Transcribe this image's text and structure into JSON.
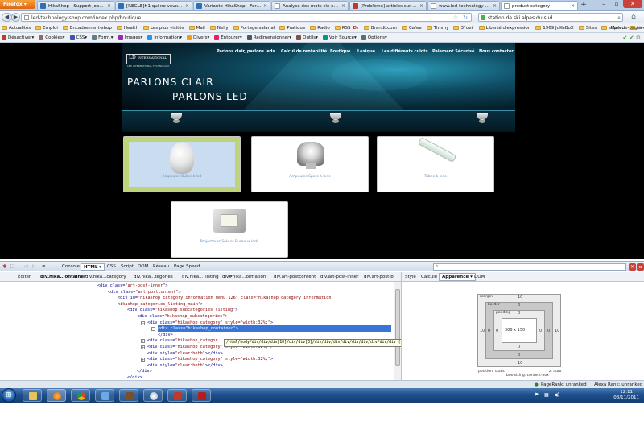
{
  "browser": {
    "app_button": "Firefox",
    "tabs": [
      {
        "label": "HikaShop - Support Joomla ..."
      },
      {
        "label": "[RÉGLÉ]H1 qui ne veux pas ..."
      },
      {
        "label": "Variante HikaShop - Formati..."
      },
      {
        "label": "Analyse des mots clé et mét..."
      },
      {
        "label": "[Problème] articles sur hikas..."
      },
      {
        "label": "www.led-technology-shop...."
      },
      {
        "label": "product category"
      }
    ],
    "url": "led-technology-shop.com/index.php/boutique",
    "search": "station de ski alpes du sud"
  },
  "bookmarks": {
    "items": [
      "Actualités",
      "Emploi",
      "Encadrement-shop",
      "Health",
      "Les plus visités",
      "Mail",
      "Nelly",
      "Portage salarial",
      "Pratique",
      "Radio",
      "RSS",
      "Brandt.com",
      "Cafee",
      "Timmy",
      "3°oeil",
      "Liberté d'expression",
      "1969 JuKeBoX",
      "Sites",
      "sup led",
      "Live"
    ],
    "rss_badge": "Dr",
    "right": "Marque-pages"
  },
  "devtoolbar": {
    "items": [
      "Désactiver",
      "Cookies",
      "CSS",
      "Form.",
      "Images",
      "Information",
      "Divers",
      "Entourer",
      "Redimensionner",
      "Outils",
      "Voir Source",
      "Options"
    ]
  },
  "site": {
    "logo": "LD",
    "logo_word": "INTERNATIONAL",
    "logo_sub": "LED INTERNATIONAL TECHNOLOGY",
    "menu": [
      "Parlons clair, parlons leds",
      "Calcul de rentabilité",
      "Boutique",
      "Lexique",
      "Les différents culots",
      "Paiement Sécurisé",
      "Nous contacter"
    ],
    "slogan_line1": "PARLONS CLAIR",
    "slogan_line2": "PARLONS LED",
    "categories": [
      {
        "name": "Ampoules Bulbe à led"
      },
      {
        "name": "Ampoules Spots à leds"
      },
      {
        "name": "Tubes à leds"
      },
      {
        "name": "Projecteurs Sols et Bureaux leds"
      }
    ]
  },
  "firebug": {
    "tabs": [
      "Console",
      "HTML",
      "CSS",
      "Script",
      "DOM",
      "Réseau",
      "Page Speed"
    ],
    "active_tab": "HTML",
    "edit_label": "Éditer",
    "crumbs": [
      "div.hika...ontainer",
      "div.hika...category",
      "div.hika...tegories",
      "div.hika..._listing",
      "div#hika...ormation",
      "div.art-postcontent",
      "div.art-post-inner",
      "div.art-post-b"
    ],
    "side_tabs": [
      "Style",
      "Calculé",
      "Apparence",
      "DOM"
    ],
    "side_active": "Apparence",
    "html_lines": [
      {
        "tag": "<div class=",
        "attr": "\"art-post-inner\"",
        "tail": ">"
      },
      {
        "tag": "<div class=",
        "attr": "\"art-postcontent\"",
        "tail": ">"
      },
      {
        "tag": "<div id=",
        "attr": "\"hikashop_category_information_menu_126\" class=\"hikashop_category_information",
        "tail": ""
      },
      {
        "tag": "",
        "attr": "hikashop_categories_listing_main\"",
        "tail": ">"
      },
      {
        "tag": "<div class=",
        "attr": "\"hikashop_subcategories_listing\"",
        "tail": ">"
      },
      {
        "tag": "<div class=",
        "attr": "\"hikashop_subcategories\"",
        "tail": ">"
      },
      {
        "tag": "<div class=",
        "attr": "\"hikashop_category\" style=\"width:32%;\"",
        "tail": ">"
      },
      {
        "tag": "<div class=",
        "attr": "\"hikashop_container\"",
        "tail": ">"
      },
      {
        "tag": "</div>",
        "attr": "",
        "tail": ""
      },
      {
        "tag": "<div class=",
        "attr": "\"hikashop_categor",
        "tail": ""
      },
      {
        "tag": "<div class=",
        "attr": "\"hikashop_category\" style=\"width:32%;\"",
        "tail": ">"
      },
      {
        "tag": "<div style=",
        "attr": "\"clear:both\"",
        "tail": "></div>"
      },
      {
        "tag": "<div class=",
        "attr": "\"hikashop_category\" style=\"width:32%;\"",
        "tail": ">"
      },
      {
        "tag": "<div style=",
        "attr": "\"clear:both\"",
        "tail": "></div>"
      },
      {
        "tag": "</div>",
        "attr": "",
        "tail": ""
      },
      {
        "tag": "</div>",
        "attr": "",
        "tail": ""
      }
    ],
    "tooltip": "/html/body/div/div/div[10]/div/div[3]/div/div/div/div/div/div/div/div/div (http://www.w3.org/1999/xhtml)",
    "box": {
      "margin_label": "margin",
      "border_label": "border",
      "padding_label": "padding",
      "margin": "10",
      "border": "0",
      "padding": "0",
      "content": "308 x 150",
      "position": "position: static",
      "sizing": "box-sizing: content-box",
      "z": "z: auto"
    }
  },
  "status": {
    "pagerank": "PageRank: unranked",
    "alexa": "Alexa Rank: unranked"
  },
  "taskbar": {
    "time": "12:11",
    "date": "08/11/2011"
  }
}
